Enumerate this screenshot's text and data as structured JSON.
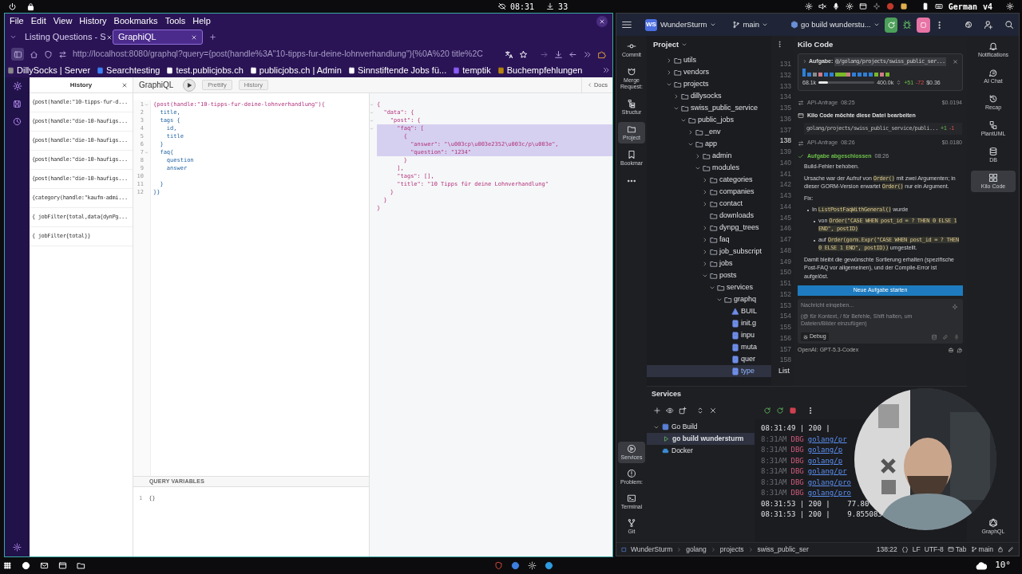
{
  "system_bar": {
    "clock": "08:31",
    "downloads": "33",
    "keyboard": "German",
    "layout": "v4"
  },
  "browser": {
    "menu": [
      "File",
      "Edit",
      "View",
      "History",
      "Bookmarks",
      "Tools",
      "Help"
    ],
    "tabs": [
      {
        "label": "Listing Questions - S",
        "selected": false
      },
      {
        "label": "GraphiQL",
        "selected": true
      }
    ],
    "url": "http://localhost:8080/graphql?query={post(handle%3A\"10-tipps-fur-deine-lohnverhandlung\"){%0A%20 title%2C",
    "bookmarks": [
      "DillySocks | Server",
      "Searchtesting",
      "test.publicjobs.ch",
      "publicjobs.ch | Admin",
      "Sinnstiftende Jobs fü...",
      "temptik",
      "Buchempfehlungen"
    ],
    "graphiql": {
      "history_panel": {
        "title": "History",
        "items": [
          "{post(handle:\"10-tipps-fur-d...",
          "{post(handle:\"die-10-haufigs...",
          "{post(handle:\"die-10-haufigs...",
          "{post(handle:\"die-10-haufigs...",
          "{post(handle:\"die-10-haufigs...",
          "{category(handle:\"kaufm-admi...",
          "{ jobFilter{total,data{dynPg...",
          "{ jobFilter{total}}"
        ]
      },
      "toolbar": {
        "title": "GraphiQL",
        "buttons": [
          "Prettify",
          "History"
        ],
        "docs": "Docs"
      },
      "query": [
        {
          "n": "1",
          "text": "{post(handle:\"10-tipps-fur-deine-lohnverhandlung\"){",
          "foldable": true
        },
        {
          "n": "2",
          "text": "  title,",
          "foldable": false
        },
        {
          "n": "3",
          "text": "  tags {",
          "foldable": false
        },
        {
          "n": "4",
          "text": "    id,",
          "foldable": false
        },
        {
          "n": "5",
          "text": "    title",
          "foldable": false
        },
        {
          "n": "6",
          "text": "  }",
          "foldable": false
        },
        {
          "n": "7",
          "text": "  faq{",
          "foldable": true
        },
        {
          "n": "8",
          "text": "    question",
          "foldable": false
        },
        {
          "n": "9",
          "text": "    answer",
          "foldable": false
        },
        {
          "n": "10",
          "foldable": false
        },
        {
          "n": "11",
          "text": "  }",
          "foldable": false
        },
        {
          "n": "12",
          "text": "}}",
          "foldable": false
        }
      ],
      "result": [
        {
          "text": "{",
          "foldable": true,
          "highlighted": false
        },
        {
          "text": "  \"data\": {",
          "foldable": true,
          "highlighted": false
        },
        {
          "text": "    \"post\": {",
          "foldable": true,
          "highlighted": false
        },
        {
          "text": "      \"faq\": [",
          "foldable": true,
          "highlighted": true
        },
        {
          "text": "        {",
          "foldable": false,
          "highlighted": true
        },
        {
          "text": "          \"answer\": \"\\u003cp\\u003e2352\\u003c/p\\u003e\",",
          "foldable": false,
          "highlighted": true
        },
        {
          "text": "          \"question\": \"1234\"",
          "foldable": false,
          "highlighted": true
        },
        {
          "text": "        }",
          "foldable": false,
          "highlighted": false
        },
        {
          "text": "      ],",
          "foldable": false,
          "highlighted": false
        },
        {
          "text": "      \"tags\": [],",
          "foldable": false,
          "highlighted": false
        },
        {
          "text": "      \"title\": \"10 Tipps für deine Lohnverhandlung\"",
          "foldable": false,
          "highlighted": false
        },
        {
          "text": "    }",
          "foldable": false,
          "highlighted": false
        },
        {
          "text": "  }",
          "foldable": false,
          "highlighted": false
        },
        {
          "text": "}",
          "foldable": false,
          "highlighted": false
        }
      ],
      "variables": {
        "title": "QUERY VARIABLES",
        "lines": [
          {
            "n": "1",
            "text": "{}"
          }
        ]
      }
    }
  },
  "ide": {
    "project_badge": "WS",
    "project": "WunderSturm",
    "branch": "main",
    "run_config": "go build wunderstu...",
    "left_tools": [
      {
        "label": "Commit",
        "kind": "commit",
        "selected": false
      },
      {
        "label": "Merge Request:",
        "kind": "merge",
        "selected": false
      },
      {
        "label": "Structur",
        "kind": "structure",
        "selected": false
      },
      {
        "label": "Project",
        "kind": "folder",
        "selected": true
      },
      {
        "label": "Bookmar",
        "kind": "bookmark",
        "selected": false
      }
    ],
    "lower_tools": [
      {
        "label": "Services",
        "kind": "services",
        "selected": true
      },
      {
        "label": "Problem:",
        "kind": "problems",
        "selected": false
      },
      {
        "label": "Terminal",
        "kind": "terminal",
        "selected": false
      },
      {
        "label": "Git",
        "kind": "git",
        "selected": false
      }
    ],
    "right_tools": [
      {
        "label": "Notifications",
        "kind": "bell",
        "selected": false
      },
      {
        "label": "AI Chat",
        "kind": "chat",
        "selected": false
      },
      {
        "label": "Recap",
        "kind": "recap",
        "selected": false
      },
      {
        "label": "PlantUML",
        "kind": "uml",
        "selected": false
      },
      {
        "label": "DB",
        "kind": "db",
        "selected": false
      },
      {
        "label": "Kilo Code",
        "kind": "kilo",
        "selected": true
      }
    ],
    "right_bottom_tool": {
      "label": "GraphQL",
      "selected": false
    },
    "project_panel": {
      "title": "Project",
      "tree": [
        {
          "name": "utils",
          "kind": "folder",
          "expanded": false,
          "selected": false
        },
        {
          "name": "vendors",
          "kind": "folder",
          "expanded": false,
          "selected": false
        },
        {
          "name": "projects",
          "kind": "folder",
          "expanded": true,
          "selected": false,
          "children": [
            {
              "name": "dillysocks",
              "kind": "folder",
              "expanded": false,
              "selected": false
            },
            {
              "name": "swiss_public_service",
              "kind": "folder",
              "expanded": true,
              "selected": false,
              "children": [
                {
                  "name": "public_jobs",
                  "kind": "folder",
                  "expanded": true,
                  "selected": false,
                  "children": [
                    {
                      "name": "_env",
                      "kind": "folder",
                      "expanded": false,
                      "selected": false
                    },
                    {
                      "name": "app",
                      "kind": "folder",
                      "expanded": true,
                      "selected": false,
                      "children": [
                        {
                          "name": "admin",
                          "kind": "folder",
                          "expanded": false,
                          "selected": false
                        },
                        {
                          "name": "modules",
                          "kind": "folder",
                          "expanded": true,
                          "selected": false,
                          "children": [
                            {
                              "name": "categories",
                              "kind": "folder",
                              "expanded": false,
                              "selected": false
                            },
                            {
                              "name": "companies",
                              "kind": "folder",
                              "expanded": false,
                              "selected": false
                            },
                            {
                              "name": "contact",
                              "kind": "folder",
                              "expanded": false,
                              "selected": false
                            },
                            {
                              "name": "downloads",
                              "kind": "empty_folder",
                              "selected": false
                            },
                            {
                              "name": "dynpg_trees",
                              "kind": "folder",
                              "expanded": false,
                              "selected": false
                            },
                            {
                              "name": "faq",
                              "kind": "folder",
                              "expanded": false,
                              "selected": false
                            },
                            {
                              "name": "job_subscript",
                              "kind": "folder",
                              "expanded": false,
                              "selected": false
                            },
                            {
                              "name": "jobs",
                              "kind": "folder",
                              "expanded": false,
                              "selected": false
                            },
                            {
                              "name": "posts",
                              "kind": "folder",
                              "expanded": true,
                              "selected": false,
                              "children": [
                                {
                                  "name": "services",
                                  "kind": "folder",
                                  "expanded": true,
                                  "selected": false,
                                  "children": [
                                    {
                                      "name": "graphq",
                                      "kind": "folder",
                                      "expanded": true,
                                      "selected": false,
                                      "children": [
                                        {
                                          "name": "BUIL",
                                          "kind": "build_file",
                                          "selected": false
                                        },
                                        {
                                          "name": "init.g",
                                          "kind": "go_file",
                                          "selected": false
                                        },
                                        {
                                          "name": "inpu",
                                          "kind": "go_file",
                                          "selected": false
                                        },
                                        {
                                          "name": "muta",
                                          "kind": "go_file",
                                          "selected": false
                                        },
                                        {
                                          "name": "quer",
                                          "kind": "go_file",
                                          "selected": false
                                        },
                                        {
                                          "name": "type",
                                          "kind": "go_file",
                                          "selected": true
                                        }
                                      ]
                                    }
                                  ]
                                }
                              ]
                            }
                          ]
                        }
                      ]
                    }
                  ]
                }
              ]
            }
          ]
        }
      ]
    },
    "gutter": [
      {
        "n": "131",
        "current": false
      },
      {
        "n": "132",
        "current": false
      },
      {
        "n": "133",
        "current": false
      },
      {
        "n": "134",
        "current": false
      },
      {
        "n": "135",
        "current": false
      },
      {
        "n": "136",
        "current": false
      },
      {
        "n": "137",
        "current": false
      },
      {
        "n": "138",
        "current": true
      },
      {
        "n": "139",
        "current": false
      },
      {
        "n": "140",
        "current": false
      },
      {
        "n": "141",
        "current": false
      },
      {
        "n": "142",
        "current": false
      },
      {
        "n": "143",
        "current": false
      },
      {
        "n": "144",
        "current": false
      },
      {
        "n": "145",
        "current": false
      },
      {
        "n": "146",
        "current": false
      },
      {
        "n": "147",
        "current": false
      },
      {
        "n": "148",
        "current": false
      },
      {
        "n": "149",
        "current": false
      },
      {
        "n": "150",
        "current": false
      },
      {
        "n": "151",
        "current": false
      },
      {
        "n": "152",
        "current": false
      },
      {
        "n": "153",
        "current": false
      },
      {
        "n": "154",
        "current": false
      },
      {
        "n": "155",
        "current": false
      },
      {
        "n": "156",
        "current": false
      },
      {
        "n": "157",
        "current": false
      },
      {
        "n": "158",
        "current": false
      }
    ],
    "gutter_note": "List",
    "kilo": {
      "title": "Kilo Code",
      "task": {
        "label": "Aufgabe:",
        "path": "@/golang/projects/swiss_public_ser...",
        "tokens": "68.1k",
        "level": 0.17,
        "limit": "400.0k",
        "added": "+51",
        "removed": "-72",
        "cost": "$0.36"
      },
      "messages": [
        {
          "kind": "api",
          "label": "API-Anfrage",
          "time": "08:25",
          "cost": "$0.0194"
        },
        {
          "kind": "edit",
          "title": "Kilo Code möchte diese Datei bearbeiten",
          "path": "golang/projects/swiss_public_service/publi...",
          "added": "+1",
          "removed": "-1"
        },
        {
          "kind": "api",
          "label": "API-Anfrage",
          "time": "08:26",
          "cost": "$0.0180"
        },
        {
          "kind": "done",
          "title": "Aufgabe abgeschlossen",
          "time": "08:26",
          "blocks": [
            {
              "kind": "p",
              "parts": [
                {
                  "text": "Build-Fehler behoben."
                }
              ]
            },
            {
              "kind": "p",
              "parts": [
                {
                  "text": "Ursache war der Aufruf von "
                },
                {
                  "text": "Order()",
                  "code": true
                },
                {
                  "text": " mit zwei Argumenten; in dieser GORM-Version erwartet "
                },
                {
                  "text": "Order()",
                  "code": true
                },
                {
                  "text": " nur ein Argument."
                }
              ]
            },
            {
              "kind": "p",
              "parts": [
                {
                  "text": "Fix:"
                }
              ]
            },
            {
              "kind": "list",
              "items": [
                {
                  "parts": [
                    {
                      "text": "In "
                    },
                    {
                      "text": "ListPostFaqWithGeneral()",
                      "code": true
                    },
                    {
                      "text": " wurde"
                    }
                  ],
                  "children": [
                    {
                      "parts": [
                        {
                          "text": "von "
                        },
                        {
                          "text": "Order(\"CASE WHEN post_id = ? THEN 0 ELSE 1 END\", postID)",
                          "code": true
                        }
                      ]
                    },
                    {
                      "parts": [
                        {
                          "text": "auf "
                        },
                        {
                          "text": "Order(gorm.Expr(\"CASE WHEN post_id = ? THEN 0 ELSE 1 END\", postID))",
                          "code": true
                        },
                        {
                          "text": " umgestellt."
                        }
                      ]
                    }
                  ]
                }
              ]
            },
            {
              "kind": "p",
              "parts": [
                {
                  "text": "Damit bleibt die gewünschte Sortierung erhalten (spezifische Post-FAQ vor allgemeinen), und der Compile-Error ist aufgelöst."
                }
              ]
            }
          ]
        }
      ],
      "new_task_button": "Neue Aufgabe starten",
      "input": {
        "placeholder": "Nachricht eingeben...",
        "hint": "(@ für Kontext, / für Befehle, Shift halten, um Dateien/Bilder einzufügen)",
        "mode": "Debug"
      },
      "model": "OpenAI: GPT-5.3-Codex"
    },
    "services": {
      "title": "Services",
      "tree": [
        {
          "name": "Go Build",
          "kind": "group",
          "expanded": true,
          "selected": false,
          "children": [
            {
              "name": "go build wundersturm",
              "kind": "run",
              "selected": true
            }
          ]
        },
        {
          "name": "Docker",
          "kind": "docker",
          "selected": false
        }
      ],
      "console": [
        {
          "kind": "http",
          "text": "08:31:49 | 200 |"
        },
        {
          "kind": "dbg",
          "time": "8:31AM",
          "level": "DBG",
          "source": "golang/pr"
        },
        {
          "kind": "dbg",
          "time": "8:31AM",
          "level": "DBG",
          "source": "golang/p"
        },
        {
          "kind": "dbg",
          "time": "8:31AM",
          "level": "DBG",
          "source": "golang/p"
        },
        {
          "kind": "dbg",
          "time": "8:31AM",
          "level": "DBG",
          "source": "golang/pr"
        },
        {
          "kind": "dbg",
          "time": "8:31AM",
          "level": "DBG",
          "source": "golang/pro"
        },
        {
          "kind": "dbg",
          "time": "8:31AM",
          "level": "DBG",
          "source": "golang/pro"
        },
        {
          "kind": "http",
          "text": "08:31:53 | 200 |    77.80"
        },
        {
          "kind": "http",
          "text": "08:31:53 | 200 |    9.855083"
        }
      ]
    },
    "status_bar": {
      "breadcrumbs": [
        "WunderSturm",
        "golang",
        "projects",
        "swiss_public_ser"
      ],
      "position": "138:22",
      "line_ending": "LF",
      "encoding": "UTF-8",
      "indent": "Tab",
      "branch": "main"
    }
  },
  "taskbar": {
    "weather": "10°"
  }
}
